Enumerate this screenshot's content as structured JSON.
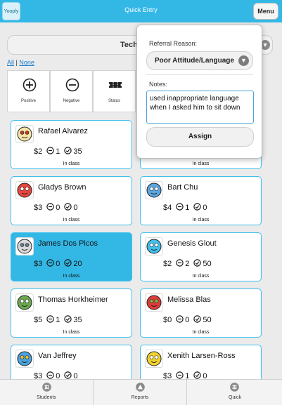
{
  "app": {
    "logo_text": "Yooply",
    "title": "Quick Entry",
    "menu_label": "Menu"
  },
  "class_selector": {
    "value": "Tech 6th G",
    "select_all": "All",
    "separator": "|",
    "select_none": "None"
  },
  "actions": [
    {
      "label": "Positive",
      "icon": "plus-circle-icon"
    },
    {
      "label": "Negative",
      "icon": "minus-circle-icon"
    },
    {
      "label": "Status",
      "icon": "ticket-icon"
    }
  ],
  "popover": {
    "reason_label": "Referral Reason:",
    "reason_value": "Poor Attitude/Language",
    "notes_label": "Notes:",
    "notes_value": "used inappropriate language when I asked him to sit down",
    "assign_label": "Assign"
  },
  "students": [
    {
      "name": "Rafael Alvarez",
      "dollars": "$2",
      "negatives": "1",
      "minutes": "35",
      "status": "In class",
      "avatar": "skull-avatar",
      "selected": false
    },
    {
      "name": "",
      "dollars": "",
      "negatives": "",
      "minutes": "",
      "status": "In class",
      "avatar": "",
      "selected": false
    },
    {
      "name": "Gladys Brown",
      "dollars": "$3",
      "negatives": "0",
      "minutes": "0",
      "status": "In class",
      "avatar": "mushroom-avatar",
      "selected": false
    },
    {
      "name": "Bart Chu",
      "dollars": "$4",
      "negatives": "1",
      "minutes": "0",
      "status": "In class",
      "avatar": "blue-monster-avatar",
      "selected": false
    },
    {
      "name": "James Dos Picos",
      "dollars": "$3",
      "negatives": "0",
      "minutes": "20",
      "status": "In class",
      "avatar": "helmet-avatar",
      "selected": true
    },
    {
      "name": "Genesis Glout",
      "dollars": "$2",
      "negatives": "2",
      "minutes": "50",
      "status": "In class",
      "avatar": "cyclops-avatar",
      "selected": false
    },
    {
      "name": "Thomas Horkheimer",
      "dollars": "$5",
      "negatives": "1",
      "minutes": "35",
      "status": "In class",
      "avatar": "goblin-avatar",
      "selected": false
    },
    {
      "name": "Melissa Blas",
      "dollars": "$0",
      "negatives": "0",
      "minutes": "50",
      "status": "In class",
      "avatar": "strawberry-avatar",
      "selected": false
    },
    {
      "name": "Van Jeffrey",
      "dollars": "$3",
      "negatives": "0",
      "minutes": "0",
      "status": "",
      "avatar": "king-avatar",
      "selected": false
    },
    {
      "name": "Xenith Larsen-Ross",
      "dollars": "$3",
      "negatives": "1",
      "minutes": "0",
      "status": "",
      "avatar": "yellow-monster-avatar",
      "selected": false
    }
  ],
  "tabs": [
    {
      "label": "Students",
      "icon": "grid-icon"
    },
    {
      "label": "Reports",
      "icon": "warning-icon"
    },
    {
      "label": "Quick",
      "icon": "grid-icon"
    }
  ],
  "colors": {
    "accent": "#33b8e6",
    "card_border": "#3fc1ec",
    "background": "#ebebeb"
  }
}
